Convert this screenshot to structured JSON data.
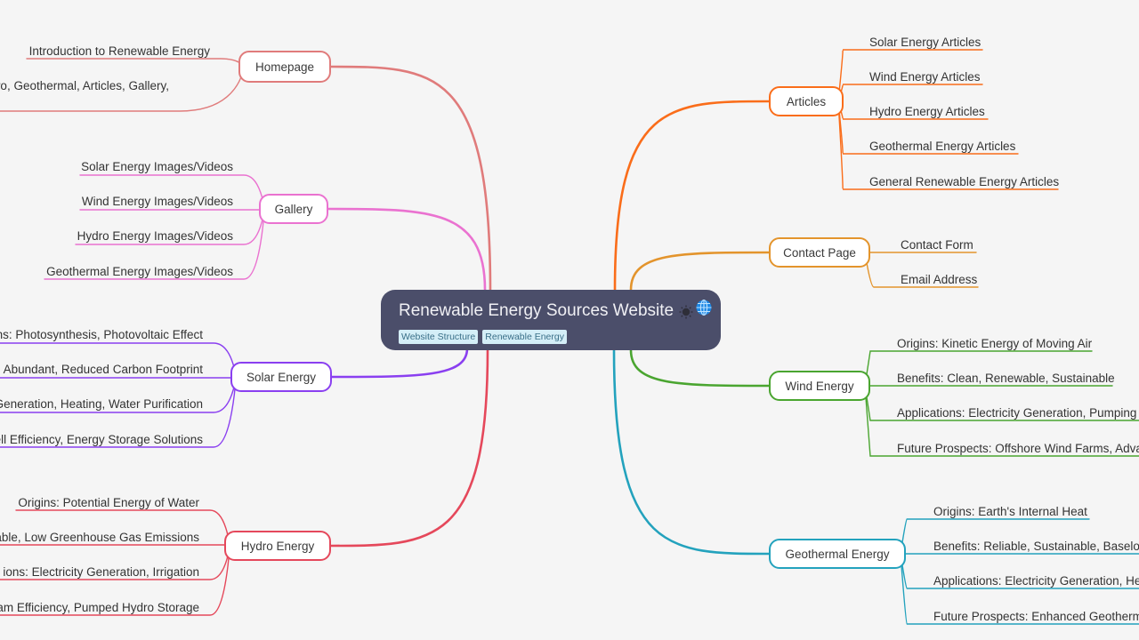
{
  "root": {
    "title": "Renewable Energy Sources Website",
    "icons": [
      "sun-icon",
      "globe-icon"
    ],
    "tags": [
      "Website Structure",
      "Renewable Energy"
    ]
  },
  "branches": [
    {
      "id": "homepage",
      "label": "Homepage",
      "color": "#e07b7b",
      "side": "left",
      "children": [
        "Introduction to Renewable Energy",
        "ro, Geothermal, Articles, Gallery,"
      ]
    },
    {
      "id": "gallery",
      "label": "Gallery",
      "color": "#ea72d0",
      "side": "left",
      "children": [
        "Solar Energy Images/Videos",
        "Wind Energy Images/Videos",
        "Hydro Energy Images/Videos",
        "Geothermal Energy Images/Videos"
      ]
    },
    {
      "id": "solar-energy",
      "label": "Solar Energy",
      "color": "#8a3ff0",
      "side": "left",
      "children": [
        "ns: Photosynthesis, Photovoltaic Effect",
        " Abundant, Reduced Carbon Footprint",
        "Generation, Heating, Water Purification",
        "ell Efficiency, Energy Storage Solutions"
      ]
    },
    {
      "id": "hydro-energy",
      "label": "Hydro Energy",
      "color": "#e5485b",
      "side": "left",
      "children": [
        "Origins: Potential Energy of Water",
        "able, Low Greenhouse Gas Emissions",
        "ions: Electricity Generation, Irrigation",
        "am Efficiency, Pumped Hydro Storage"
      ]
    },
    {
      "id": "articles",
      "label": "Articles",
      "color": "#fa6d1a",
      "side": "right",
      "children": [
        "Solar Energy Articles",
        "Wind Energy Articles",
        "Hydro Energy Articles",
        "Geothermal Energy Articles",
        "General Renewable Energy Articles"
      ]
    },
    {
      "id": "contact-page",
      "label": "Contact Page",
      "color": "#e3942c",
      "side": "right",
      "children": [
        "Contact Form",
        "Email Address"
      ]
    },
    {
      "id": "wind-energy",
      "label": "Wind Energy",
      "color": "#4aa530",
      "side": "right",
      "children": [
        "Origins: Kinetic Energy of Moving Air",
        "Benefits: Clean, Renewable, Sustainable",
        "Applications: Electricity Generation, Pumping",
        "Future Prospects: Offshore Wind Farms, Advan"
      ]
    },
    {
      "id": "geothermal-energy",
      "label": "Geothermal Energy",
      "color": "#23a2bd",
      "side": "right",
      "children": [
        "Origins: Earth's Internal Heat",
        "Benefits: Reliable, Sustainable, Baseloa",
        "Applications: Electricity Generation, He",
        "Future Prospects: Enhanced Geotherm"
      ]
    }
  ]
}
